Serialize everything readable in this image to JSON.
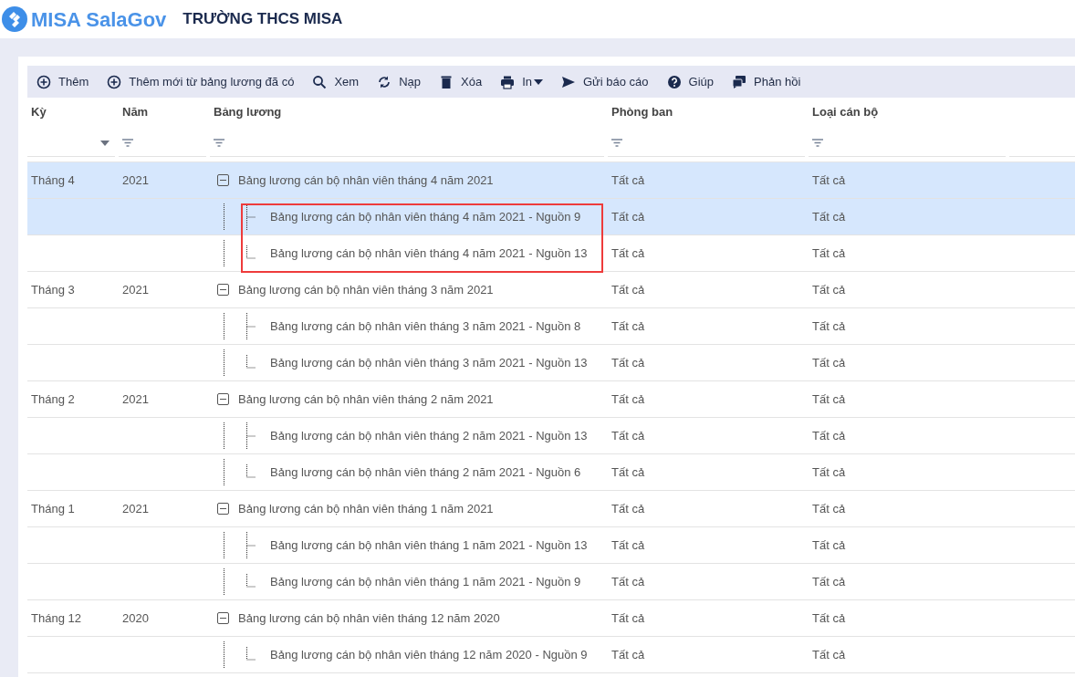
{
  "app": {
    "logo": "MISA SalaGov",
    "organization": "TRƯỜNG THCS MISA"
  },
  "toolbar": [
    {
      "label": "Thêm",
      "dropdown": false
    },
    {
      "label": "Thêm mới từ bảng lương đã có",
      "dropdown": false
    },
    {
      "label": "Xem",
      "dropdown": false
    },
    {
      "label": "Nạp",
      "dropdown": false
    },
    {
      "label": "Xóa",
      "dropdown": false
    },
    {
      "label": "In",
      "dropdown": true
    },
    {
      "label": "Gửi báo cáo",
      "dropdown": false
    },
    {
      "label": "Giúp",
      "dropdown": false
    },
    {
      "label": "Phản hồi",
      "dropdown": false
    }
  ],
  "table": {
    "columns": [
      {
        "label": "Kỳ"
      },
      {
        "label": "Năm"
      },
      {
        "label": "Bảng lương"
      },
      {
        "label": "Phòng ban"
      },
      {
        "label": "Loại cán bộ"
      }
    ],
    "rows": [
      {
        "period": "Tháng 4",
        "year": "2021",
        "name": "Bảng lương cán bộ nhân viên tháng 4 năm 2021",
        "department": "Tất cả",
        "staff_type": "Tất cả",
        "expanded": true,
        "selected": true,
        "children_highlighted": true,
        "children": [
          {
            "name": "Bảng lương cán bộ nhân viên tháng 4 năm 2021 - Nguồn 9",
            "department": "Tất cả",
            "staff_type": "Tất cả",
            "selected": true
          },
          {
            "name": "Bảng lương cán bộ nhân viên tháng 4 năm 2021 - Nguồn 13",
            "department": "Tất cả",
            "staff_type": "Tất cả",
            "selected": false
          }
        ]
      },
      {
        "period": "Tháng 3",
        "year": "2021",
        "name": "Bảng lương cán bộ nhân viên tháng 3 năm 2021",
        "department": "Tất cả",
        "staff_type": "Tất cả",
        "expanded": true,
        "selected": false,
        "children_highlighted": false,
        "children": [
          {
            "name": "Bảng lương cán bộ nhân viên tháng 3 năm 2021 - Nguồn 8",
            "department": "Tất cả",
            "staff_type": "Tất cả",
            "selected": false
          },
          {
            "name": "Bảng lương cán bộ nhân viên tháng 3 năm 2021 - Nguồn 13",
            "department": "Tất cả",
            "staff_type": "Tất cả",
            "selected": false
          }
        ]
      },
      {
        "period": "Tháng 2",
        "year": "2021",
        "name": "Bảng lương cán bộ nhân viên tháng 2 năm 2021",
        "department": "Tất cả",
        "staff_type": "Tất cả",
        "expanded": true,
        "selected": false,
        "children_highlighted": false,
        "children": [
          {
            "name": "Bảng lương cán bộ nhân viên tháng 2 năm 2021 - Nguồn 13",
            "department": "Tất cả",
            "staff_type": "Tất cả",
            "selected": false
          },
          {
            "name": "Bảng lương cán bộ nhân viên tháng 2 năm 2021 - Nguồn 6",
            "department": "Tất cả",
            "staff_type": "Tất cả",
            "selected": false
          }
        ]
      },
      {
        "period": "Tháng 1",
        "year": "2021",
        "name": "Bảng lương cán bộ nhân viên tháng 1 năm 2021",
        "department": "Tất cả",
        "staff_type": "Tất cả",
        "expanded": true,
        "selected": false,
        "children_highlighted": false,
        "children": [
          {
            "name": "Bảng lương cán bộ nhân viên tháng 1 năm 2021 - Nguồn 13",
            "department": "Tất cả",
            "staff_type": "Tất cả",
            "selected": false
          },
          {
            "name": "Bảng lương cán bộ nhân viên tháng 1 năm 2021 - Nguồn 9",
            "department": "Tất cả",
            "staff_type": "Tất cả",
            "selected": false
          }
        ]
      },
      {
        "period": "Tháng 12",
        "year": "2020",
        "name": "Bảng lương cán bộ nhân viên tháng 12 năm 2020",
        "department": "Tất cả",
        "staff_type": "Tất cả",
        "expanded": true,
        "selected": false,
        "children_highlighted": false,
        "children": [
          {
            "name": "Bảng lương cán bộ nhân viên tháng 12 năm 2020 - Nguồn 9",
            "department": "Tất cả",
            "staff_type": "Tất cả",
            "selected": false
          }
        ]
      }
    ]
  }
}
